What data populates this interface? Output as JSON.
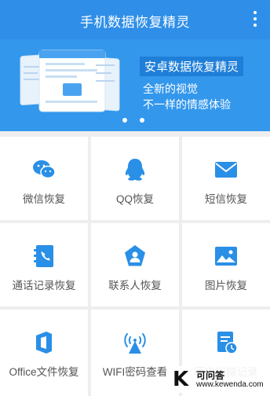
{
  "app": {
    "title": "手机数据恢复精灵",
    "menu_icon": "more-vertical-icon"
  },
  "banner": {
    "headline": "安卓数据恢复精灵",
    "line1": "全新的视觉",
    "line2": "不一样的情感体验",
    "page_count": 2,
    "current_page": 1
  },
  "grid": {
    "items": [
      {
        "label": "微信恢复",
        "icon": "wechat-icon"
      },
      {
        "label": "QQ恢复",
        "icon": "qq-icon"
      },
      {
        "label": "短信恢复",
        "icon": "envelope-icon"
      },
      {
        "label": "通话记录恢复",
        "icon": "call-log-icon"
      },
      {
        "label": "联系人恢复",
        "icon": "contact-icon"
      },
      {
        "label": "图片恢复",
        "icon": "image-icon"
      },
      {
        "label": "Office文件恢复",
        "icon": "office-icon"
      },
      {
        "label": "WIFI密码查看",
        "icon": "wifi-icon"
      },
      {
        "label": "历史扫描记录",
        "icon": "history-icon"
      }
    ]
  },
  "watermark": {
    "letter": "K",
    "name": "可问答",
    "url": "www.kewenda.com"
  },
  "colors": {
    "primary": "#2f8fe8",
    "banner": "#3397ec",
    "icon": "#2a8fe6",
    "background": "#eeeeee"
  }
}
